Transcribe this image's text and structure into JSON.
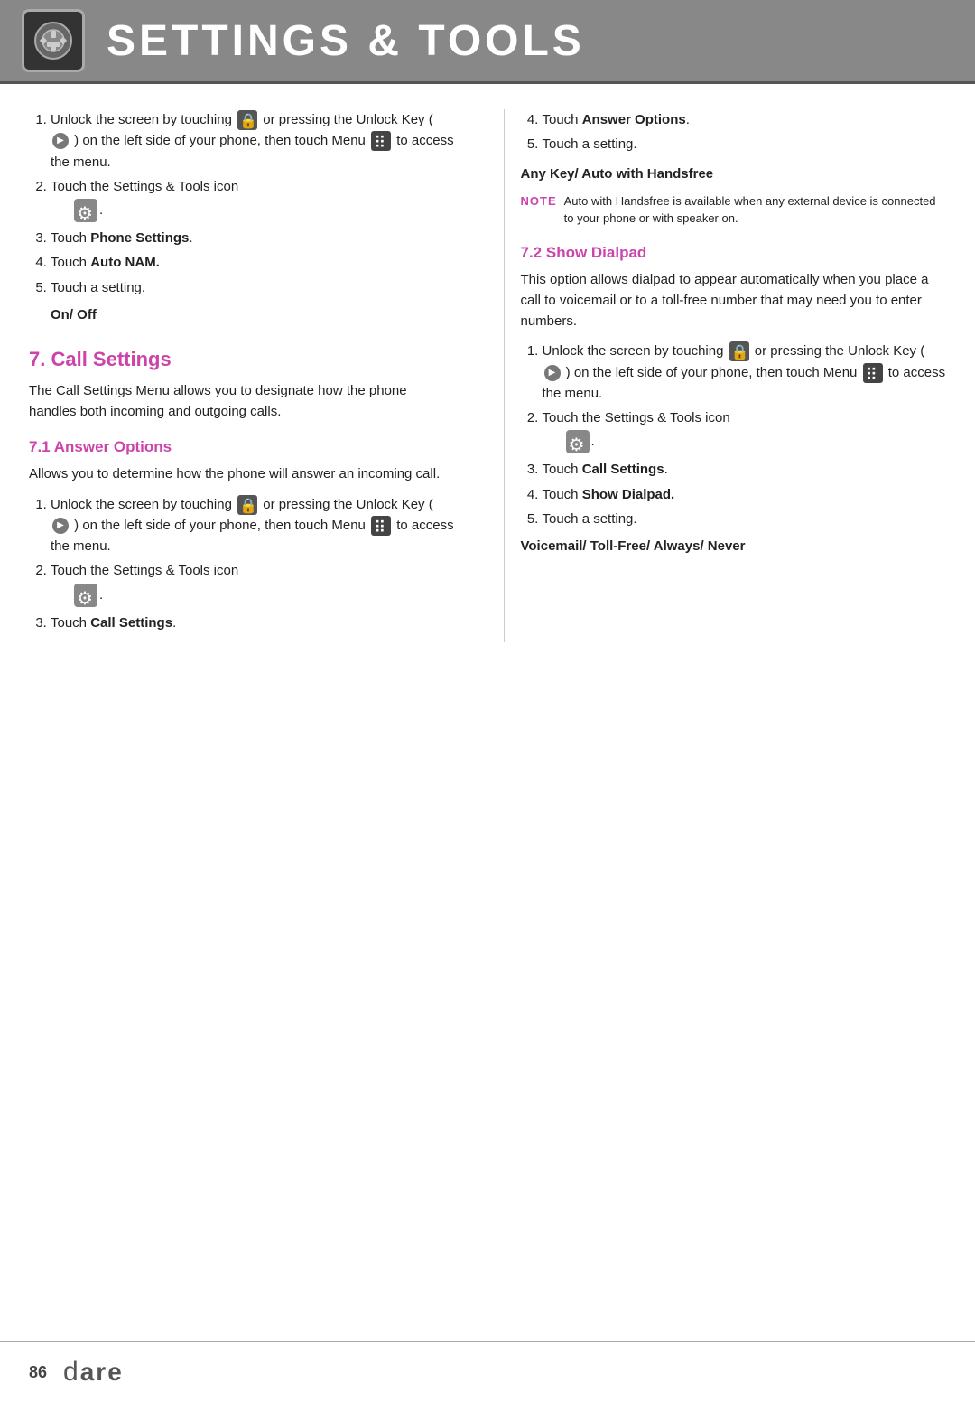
{
  "header": {
    "title": "SETTINGS & TOOLS"
  },
  "left_column": {
    "step1_intro": "Unlock the screen by touching",
    "step1_mid": "or pressing the Unlock Key",
    "step1_paren": "(",
    "step1_paren2": ") on the left side of your phone, then touch Menu",
    "step1_end": "to access the menu.",
    "step2": "Touch the Settings & Tools icon",
    "step3": "Touch ",
    "step3_bold": "Phone Settings",
    "step4": "Touch ",
    "step4_bold": "Auto NAM.",
    "step5": "Touch a setting.",
    "on_off": "On/ Off",
    "section7_label": "7. Call Settings",
    "section7_desc": "The Call Settings Menu allows you to designate how the phone handles both incoming and outgoing calls.",
    "section71_label": "7.1 Answer Options",
    "section71_desc": "Allows you to determine how the phone will answer an incoming call.",
    "s71_step1_a": "Unlock the screen by touching",
    "s71_step1_b": "or pressing the Unlock Key",
    "s71_step1_c": "( ",
    "s71_step1_d": " ) on the left side of your phone, then touch Menu",
    "s71_step1_e": "to access the menu.",
    "s71_step2": "Touch the Settings & Tools icon",
    "s71_step3": "Touch ",
    "s71_step3_bold": "Call Settings",
    "steps_labels": [
      "1.",
      "2.",
      "3.",
      "4.",
      "5."
    ]
  },
  "right_column": {
    "step4": "Touch ",
    "step4_bold": "Answer Options",
    "step5": "Touch a setting.",
    "any_key_label": "Any Key/ Auto with Handsfree",
    "note_label": "NOTE",
    "note_text": "Auto with Handsfree is available when any external device is connected to your phone or with speaker on.",
    "section72_label": "7.2 Show Dialpad",
    "section72_desc": "This option allows dialpad to appear automatically when you place a call to voicemail or to a toll-free number that may need you to enter numbers.",
    "s72_step1_a": "Unlock the screen by touching",
    "s72_step1_b": "or pressing the Unlock Key",
    "s72_step1_c": "(",
    "s72_step1_d": ") on the left side of your phone, then touch Menu",
    "s72_step1_e": "to access the menu.",
    "s72_step2": "Touch the Settings & Tools icon",
    "s72_step3": "Touch ",
    "s72_step3_bold": "Call Settings",
    "s72_step4": "Touch ",
    "s72_step4_bold": "Show Dialpad.",
    "s72_step5": "Touch a setting.",
    "voicemail_label": "Voicemail/ Toll-Free/ Always/ Never"
  },
  "footer": {
    "page_number": "86",
    "brand_logo": "Dare"
  }
}
